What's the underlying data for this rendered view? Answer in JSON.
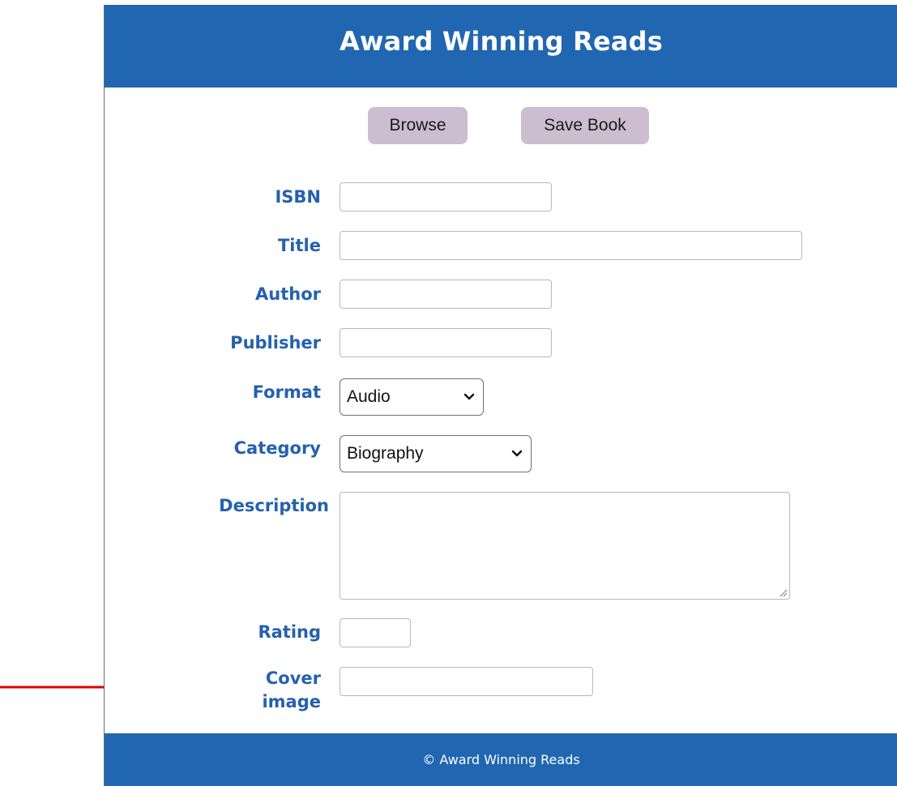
{
  "header": {
    "title": "Award Winning Reads"
  },
  "toolbar": {
    "browse_label": "Browse",
    "save_label": "Save Book"
  },
  "form": {
    "isbn_label": "ISBN",
    "title_label": "Title",
    "author_label": "Author",
    "publisher_label": "Publisher",
    "format_label": "Format",
    "format_value": "Audio",
    "category_label": "Category",
    "category_value": "Biography",
    "description_label": "Description",
    "rating_label": "Rating",
    "cover_label": "Cover image",
    "isbn_value": "",
    "title_value": "",
    "author_value": "",
    "publisher_value": "",
    "description_value": "",
    "rating_value": "",
    "cover_value": ""
  },
  "footer": {
    "text": "© Award Winning Reads"
  },
  "colors": {
    "brand_blue": "#2166b1",
    "label_blue": "#2561ad",
    "button_bg": "#cdbdd0",
    "annotation_arrow": "#e00000"
  },
  "icons": {
    "select_chevron": "chevron-down-icon",
    "annotation": "arrow-right-icon"
  }
}
